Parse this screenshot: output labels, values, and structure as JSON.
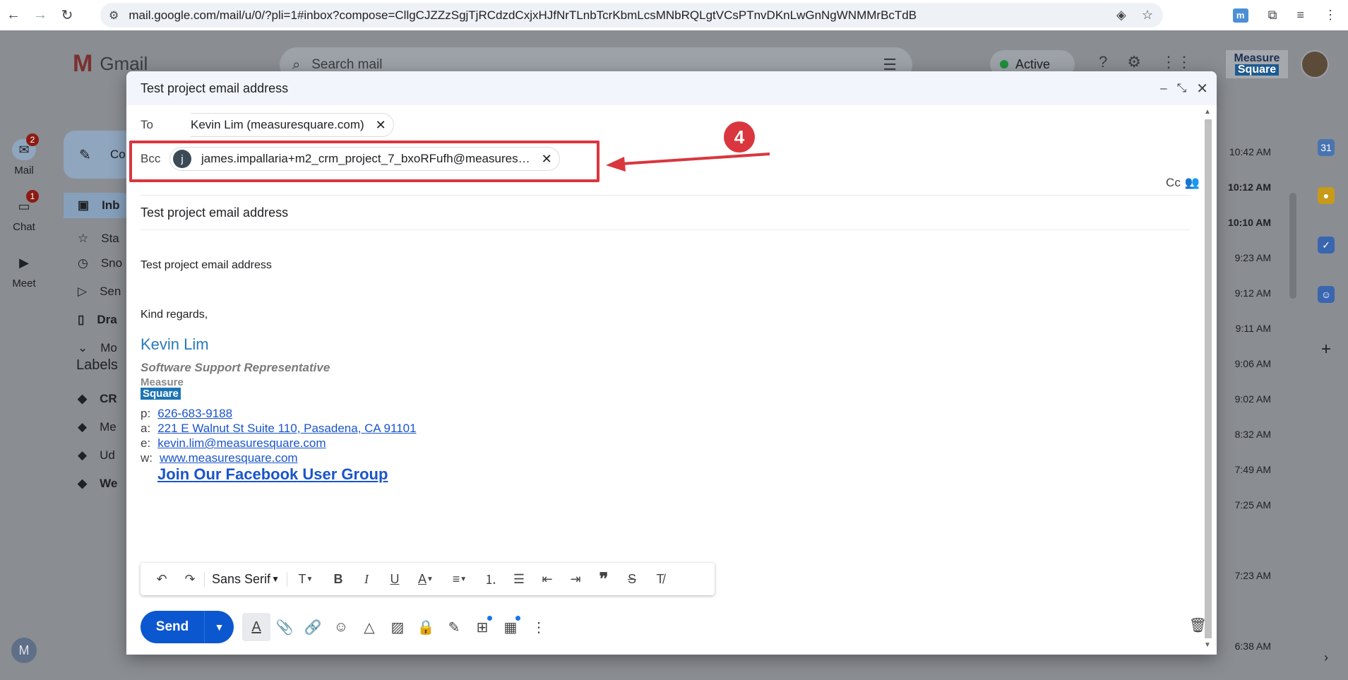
{
  "browser": {
    "url": "mail.google.com/mail/u/0/?pli=1#inbox?compose=CllgCJZZzSgjTjRCdzdCxjxHJfNrTLnbTcrKbmLcsMNbRQLgtVCsPTnvDKnLwGnNgWNMMrBcTdB"
  },
  "gmail": {
    "logo_text": "Gmail",
    "search_placeholder": "Search mail",
    "status": "Active",
    "brand_line1": "Measure",
    "brand_line2": "Square",
    "rail": [
      {
        "label": "Mail",
        "badge": "2"
      },
      {
        "label": "Chat",
        "badge": "1"
      },
      {
        "label": "Meet",
        "badge": ""
      }
    ],
    "rail_user_initial": "M",
    "nav": [
      "Inb",
      "Sta",
      "Sno",
      "Sen",
      "Dra",
      "Mo"
    ],
    "compose_label": "Co",
    "labels_heading": "Labels",
    "labels": [
      "CR",
      "Me",
      "Ud",
      "We"
    ],
    "times": [
      "10:42 AM",
      "10:12 AM",
      "10:10 AM",
      "9:23 AM",
      "9:12 AM",
      "9:11 AM",
      "9:06 AM",
      "9:02 AM",
      "8:32 AM",
      "7:49 AM",
      "7:25 AM",
      "7:23 AM",
      "6:38 AM"
    ]
  },
  "compose": {
    "window_title": "Test project email address",
    "to_label": "To",
    "to_recipient": "Kevin Lim (measuresquare.com)",
    "bcc_label": "Bcc",
    "bcc_avatar": "j",
    "bcc_recipient": "james.impallaria+m2_crm_project_7_bxoRFufh@measures…",
    "cc_label": "Cc",
    "subject": "Test project email address",
    "body_line1": "Test project email address",
    "body_line2": "Kind regards,",
    "signature": {
      "name": "Kevin Lim",
      "title": "Software Support Representative",
      "logo_line1": "Measure",
      "logo_line2": "Square",
      "phone_label": "p:",
      "phone": "626-683-9188",
      "address_label": "a:",
      "address": "221 E Walnut St Suite 110, Pasadena, CA 91101",
      "email_label": "e:",
      "email": "kevin.lim@measuresquare.com",
      "web_label": "w:",
      "web": "www.measuresquare.com",
      "facebook": "Join Our Facebook User Group"
    },
    "font_name": "Sans Serif",
    "send_label": "Send"
  },
  "annotation": {
    "step_number": "4",
    "color": "#d9363e"
  }
}
